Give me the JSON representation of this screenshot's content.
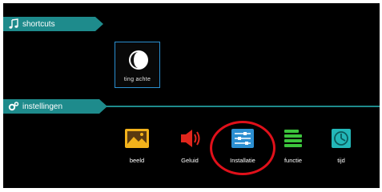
{
  "sections": {
    "shortcuts": {
      "title": "shortcuts",
      "icon": "music-note-icon"
    },
    "instellingen": {
      "title": "instellingen",
      "icon": "gears-icon"
    }
  },
  "shortcut_tile": {
    "label": "ting    achte",
    "icon": "moon-icon"
  },
  "menu": {
    "items": [
      {
        "label": "beeld",
        "icon": "picture-icon"
      },
      {
        "label": "Geluid",
        "icon": "speaker-icon"
      },
      {
        "label": "Installatie",
        "icon": "sliders-icon"
      },
      {
        "label": "functie",
        "icon": "list-icon"
      },
      {
        "label": "tijd",
        "icon": "clock-icon"
      }
    ]
  },
  "colors": {
    "accent": "#1e8b8c",
    "highlight": "#e0101a",
    "focus_border": "#2a8fd0"
  }
}
